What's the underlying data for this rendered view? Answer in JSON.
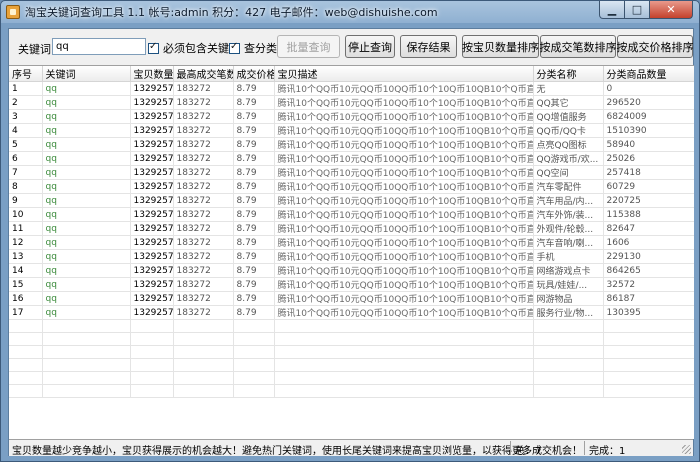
{
  "window": {
    "title": "淘宝关键词查询工具 1.1 帐号:admin 积分：427 电子邮件：web@dishuishe.com",
    "icon": "app-icon"
  },
  "toolbar": {
    "keyword_label": "关键词",
    "keyword_value": "qq",
    "must_contain_label": "必须包含关键词",
    "must_contain_checked": true,
    "check_category_label": "查分类",
    "check_category_checked": true,
    "batch_query_label": "批量查询",
    "stop_query_label": "停止查询",
    "save_result_label": "保存结果",
    "sort_by_count_label": "按宝贝数量排序",
    "sort_by_deals_label": "按成交笔数排序",
    "sort_by_price_label": "按成交价格排序"
  },
  "grid": {
    "columns": [
      "序号",
      "关键词",
      "宝贝数量",
      "最高成交笔数",
      "成交价格",
      "宝贝描述",
      "分类名称",
      "分类商品数量"
    ],
    "rows": [
      {
        "idx": "1",
        "kw": "qq",
        "count": "13292579",
        "deals": "183272",
        "price": "8.79",
        "desc": "腾讯10个QQ币10元QQ币10QQ币10个10Q币10QB10个Q币直充★自...",
        "cat": "无",
        "cat_count": "0"
      },
      {
        "idx": "2",
        "kw": "qq",
        "count": "13292579",
        "deals": "183272",
        "price": "8.79",
        "desc": "腾讯10个QQ币10元QQ币10QQ币10个10Q币10QB10个Q币直充★自...",
        "cat": "QQ其它",
        "cat_count": "296520"
      },
      {
        "idx": "3",
        "kw": "qq",
        "count": "13292579",
        "deals": "183272",
        "price": "8.79",
        "desc": "腾讯10个QQ币10元QQ币10QQ币10个10Q币10QB10个Q币直充★自...",
        "cat": "QQ增值服务",
        "cat_count": "6824009"
      },
      {
        "idx": "4",
        "kw": "qq",
        "count": "13292579",
        "deals": "183272",
        "price": "8.79",
        "desc": "腾讯10个QQ币10元QQ币10QQ币10个10Q币10QB10个Q币直充★自...",
        "cat": "QQ币/QQ卡",
        "cat_count": "1510390"
      },
      {
        "idx": "5",
        "kw": "qq",
        "count": "13292579",
        "deals": "183272",
        "price": "8.79",
        "desc": "腾讯10个QQ币10元QQ币10QQ币10个10Q币10QB10个Q币直充★自...",
        "cat": "点亮QQ图标",
        "cat_count": "58940"
      },
      {
        "idx": "6",
        "kw": "qq",
        "count": "13292579",
        "deals": "183272",
        "price": "8.79",
        "desc": "腾讯10个QQ币10元QQ币10QQ币10个10Q币10QB10个Q币直充★自...",
        "cat": "QQ游戏币/欢...",
        "cat_count": "25026"
      },
      {
        "idx": "7",
        "kw": "qq",
        "count": "13292579",
        "deals": "183272",
        "price": "8.79",
        "desc": "腾讯10个QQ币10元QQ币10QQ币10个10Q币10QB10个Q币直充★自...",
        "cat": "QQ空间",
        "cat_count": "257418"
      },
      {
        "idx": "8",
        "kw": "qq",
        "count": "13292579",
        "deals": "183272",
        "price": "8.79",
        "desc": "腾讯10个QQ币10元QQ币10QQ币10个10Q币10QB10个Q币直充★自...",
        "cat": "汽车零配件",
        "cat_count": "60729"
      },
      {
        "idx": "9",
        "kw": "qq",
        "count": "13292579",
        "deals": "183272",
        "price": "8.79",
        "desc": "腾讯10个QQ币10元QQ币10QQ币10个10Q币10QB10个Q币直充★自...",
        "cat": "汽车用品/内...",
        "cat_count": "220725"
      },
      {
        "idx": "10",
        "kw": "qq",
        "count": "13292579",
        "deals": "183272",
        "price": "8.79",
        "desc": "腾讯10个QQ币10元QQ币10QQ币10个10Q币10QB10个Q币直充★自...",
        "cat": "汽车外饰/装...",
        "cat_count": "115388"
      },
      {
        "idx": "11",
        "kw": "qq",
        "count": "13292579",
        "deals": "183272",
        "price": "8.79",
        "desc": "腾讯10个QQ币10元QQ币10QQ币10个10Q币10QB10个Q币直充★自...",
        "cat": "外观件/轮毂...",
        "cat_count": "82647"
      },
      {
        "idx": "12",
        "kw": "qq",
        "count": "13292579",
        "deals": "183272",
        "price": "8.79",
        "desc": "腾讯10个QQ币10元QQ币10QQ币10个10Q币10QB10个Q币直充★自...",
        "cat": "汽车音响/喇...",
        "cat_count": "1606"
      },
      {
        "idx": "13",
        "kw": "qq",
        "count": "13292579",
        "deals": "183272",
        "price": "8.79",
        "desc": "腾讯10个QQ币10元QQ币10QQ币10个10Q币10QB10个Q币直充★自...",
        "cat": "手机",
        "cat_count": "229130"
      },
      {
        "idx": "14",
        "kw": "qq",
        "count": "13292579",
        "deals": "183272",
        "price": "8.79",
        "desc": "腾讯10个QQ币10元QQ币10QQ币10个10Q币10QB10个Q币直充★自...",
        "cat": "网络游戏点卡",
        "cat_count": "864265"
      },
      {
        "idx": "15",
        "kw": "qq",
        "count": "13292579",
        "deals": "183272",
        "price": "8.79",
        "desc": "腾讯10个QQ币10元QQ币10QQ币10个10Q币10QB10个Q币直充★自...",
        "cat": "玩具/娃娃/...",
        "cat_count": "32572"
      },
      {
        "idx": "16",
        "kw": "qq",
        "count": "13292579",
        "deals": "183272",
        "price": "8.79",
        "desc": "腾讯10个QQ币10元QQ币10QQ币10个10Q币10QB10个Q币直充★自...",
        "cat": "网游物品",
        "cat_count": "86187"
      },
      {
        "idx": "17",
        "kw": "qq",
        "count": "13292579",
        "deals": "183272",
        "price": "8.79",
        "desc": "腾讯10个QQ币10元QQ币10QQ币10个10Q币10QB10个Q币直充★自...",
        "cat": "服务行业/物...",
        "cat_count": "130395"
      }
    ]
  },
  "statusbar": {
    "tip": "宝贝数量越少竞争越小，宝贝获得展示的机会越大！避免热门关键词，使用长尾关键词来提高宝贝浏览量，以获得更多成交机会！",
    "total": "总：7",
    "done": "完成：1"
  },
  "colors": {
    "title_gradient_top": "#a9c4de",
    "keyword_green": "#3a8a3a",
    "close_button": "#c4412c"
  }
}
